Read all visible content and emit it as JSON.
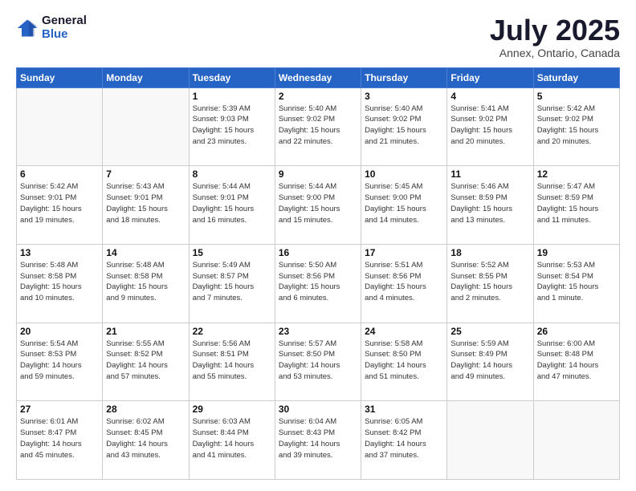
{
  "logo": {
    "general": "General",
    "blue": "Blue"
  },
  "header": {
    "month": "July 2025",
    "location": "Annex, Ontario, Canada"
  },
  "days_of_week": [
    "Sunday",
    "Monday",
    "Tuesday",
    "Wednesday",
    "Thursday",
    "Friday",
    "Saturday"
  ],
  "weeks": [
    [
      {
        "day": "",
        "sunrise": "",
        "sunset": "",
        "daylight": ""
      },
      {
        "day": "",
        "sunrise": "",
        "sunset": "",
        "daylight": ""
      },
      {
        "day": "1",
        "sunrise": "Sunrise: 5:39 AM",
        "sunset": "Sunset: 9:03 PM",
        "daylight": "Daylight: 15 hours and 23 minutes."
      },
      {
        "day": "2",
        "sunrise": "Sunrise: 5:40 AM",
        "sunset": "Sunset: 9:02 PM",
        "daylight": "Daylight: 15 hours and 22 minutes."
      },
      {
        "day": "3",
        "sunrise": "Sunrise: 5:40 AM",
        "sunset": "Sunset: 9:02 PM",
        "daylight": "Daylight: 15 hours and 21 minutes."
      },
      {
        "day": "4",
        "sunrise": "Sunrise: 5:41 AM",
        "sunset": "Sunset: 9:02 PM",
        "daylight": "Daylight: 15 hours and 20 minutes."
      },
      {
        "day": "5",
        "sunrise": "Sunrise: 5:42 AM",
        "sunset": "Sunset: 9:02 PM",
        "daylight": "Daylight: 15 hours and 20 minutes."
      }
    ],
    [
      {
        "day": "6",
        "sunrise": "Sunrise: 5:42 AM",
        "sunset": "Sunset: 9:01 PM",
        "daylight": "Daylight: 15 hours and 19 minutes."
      },
      {
        "day": "7",
        "sunrise": "Sunrise: 5:43 AM",
        "sunset": "Sunset: 9:01 PM",
        "daylight": "Daylight: 15 hours and 18 minutes."
      },
      {
        "day": "8",
        "sunrise": "Sunrise: 5:44 AM",
        "sunset": "Sunset: 9:01 PM",
        "daylight": "Daylight: 15 hours and 16 minutes."
      },
      {
        "day": "9",
        "sunrise": "Sunrise: 5:44 AM",
        "sunset": "Sunset: 9:00 PM",
        "daylight": "Daylight: 15 hours and 15 minutes."
      },
      {
        "day": "10",
        "sunrise": "Sunrise: 5:45 AM",
        "sunset": "Sunset: 9:00 PM",
        "daylight": "Daylight: 15 hours and 14 minutes."
      },
      {
        "day": "11",
        "sunrise": "Sunrise: 5:46 AM",
        "sunset": "Sunset: 8:59 PM",
        "daylight": "Daylight: 15 hours and 13 minutes."
      },
      {
        "day": "12",
        "sunrise": "Sunrise: 5:47 AM",
        "sunset": "Sunset: 8:59 PM",
        "daylight": "Daylight: 15 hours and 11 minutes."
      }
    ],
    [
      {
        "day": "13",
        "sunrise": "Sunrise: 5:48 AM",
        "sunset": "Sunset: 8:58 PM",
        "daylight": "Daylight: 15 hours and 10 minutes."
      },
      {
        "day": "14",
        "sunrise": "Sunrise: 5:48 AM",
        "sunset": "Sunset: 8:58 PM",
        "daylight": "Daylight: 15 hours and 9 minutes."
      },
      {
        "day": "15",
        "sunrise": "Sunrise: 5:49 AM",
        "sunset": "Sunset: 8:57 PM",
        "daylight": "Daylight: 15 hours and 7 minutes."
      },
      {
        "day": "16",
        "sunrise": "Sunrise: 5:50 AM",
        "sunset": "Sunset: 8:56 PM",
        "daylight": "Daylight: 15 hours and 6 minutes."
      },
      {
        "day": "17",
        "sunrise": "Sunrise: 5:51 AM",
        "sunset": "Sunset: 8:56 PM",
        "daylight": "Daylight: 15 hours and 4 minutes."
      },
      {
        "day": "18",
        "sunrise": "Sunrise: 5:52 AM",
        "sunset": "Sunset: 8:55 PM",
        "daylight": "Daylight: 15 hours and 2 minutes."
      },
      {
        "day": "19",
        "sunrise": "Sunrise: 5:53 AM",
        "sunset": "Sunset: 8:54 PM",
        "daylight": "Daylight: 15 hours and 1 minute."
      }
    ],
    [
      {
        "day": "20",
        "sunrise": "Sunrise: 5:54 AM",
        "sunset": "Sunset: 8:53 PM",
        "daylight": "Daylight: 14 hours and 59 minutes."
      },
      {
        "day": "21",
        "sunrise": "Sunrise: 5:55 AM",
        "sunset": "Sunset: 8:52 PM",
        "daylight": "Daylight: 14 hours and 57 minutes."
      },
      {
        "day": "22",
        "sunrise": "Sunrise: 5:56 AM",
        "sunset": "Sunset: 8:51 PM",
        "daylight": "Daylight: 14 hours and 55 minutes."
      },
      {
        "day": "23",
        "sunrise": "Sunrise: 5:57 AM",
        "sunset": "Sunset: 8:50 PM",
        "daylight": "Daylight: 14 hours and 53 minutes."
      },
      {
        "day": "24",
        "sunrise": "Sunrise: 5:58 AM",
        "sunset": "Sunset: 8:50 PM",
        "daylight": "Daylight: 14 hours and 51 minutes."
      },
      {
        "day": "25",
        "sunrise": "Sunrise: 5:59 AM",
        "sunset": "Sunset: 8:49 PM",
        "daylight": "Daylight: 14 hours and 49 minutes."
      },
      {
        "day": "26",
        "sunrise": "Sunrise: 6:00 AM",
        "sunset": "Sunset: 8:48 PM",
        "daylight": "Daylight: 14 hours and 47 minutes."
      }
    ],
    [
      {
        "day": "27",
        "sunrise": "Sunrise: 6:01 AM",
        "sunset": "Sunset: 8:47 PM",
        "daylight": "Daylight: 14 hours and 45 minutes."
      },
      {
        "day": "28",
        "sunrise": "Sunrise: 6:02 AM",
        "sunset": "Sunset: 8:45 PM",
        "daylight": "Daylight: 14 hours and 43 minutes."
      },
      {
        "day": "29",
        "sunrise": "Sunrise: 6:03 AM",
        "sunset": "Sunset: 8:44 PM",
        "daylight": "Daylight: 14 hours and 41 minutes."
      },
      {
        "day": "30",
        "sunrise": "Sunrise: 6:04 AM",
        "sunset": "Sunset: 8:43 PM",
        "daylight": "Daylight: 14 hours and 39 minutes."
      },
      {
        "day": "31",
        "sunrise": "Sunrise: 6:05 AM",
        "sunset": "Sunset: 8:42 PM",
        "daylight": "Daylight: 14 hours and 37 minutes."
      },
      {
        "day": "",
        "sunrise": "",
        "sunset": "",
        "daylight": ""
      },
      {
        "day": "",
        "sunrise": "",
        "sunset": "",
        "daylight": ""
      }
    ]
  ]
}
